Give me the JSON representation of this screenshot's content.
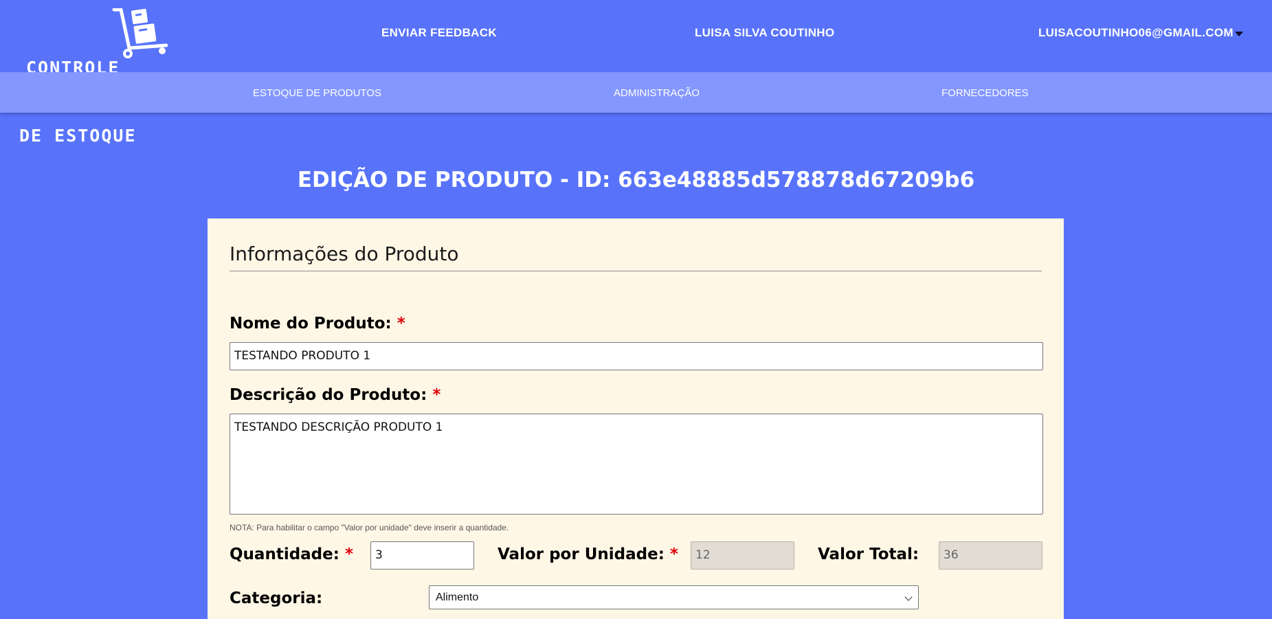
{
  "logo": {
    "line1": "CONTROLE",
    "line2": "DE ESTOQUE",
    "icon": "hand-truck-boxes-icon"
  },
  "header": {
    "feedback": "ENVIAR FEEDBACK",
    "user_name": "LUISA SILVA COUTINHO",
    "user_email": "LUISACOUTINHO06@GMAIL.COM",
    "dropdown_icon": "caret-down-icon"
  },
  "nav": {
    "items": [
      {
        "label": "ESTOQUE DE PRODUTOS"
      },
      {
        "label": "ADMINISTRAÇÃO"
      },
      {
        "label": "FORNECEDORES"
      }
    ]
  },
  "page": {
    "title": "EDIÇÃO DE PRODUTO - ID: 663e48885d578878d67209b6"
  },
  "form": {
    "section_title": "Informações do Produto",
    "required_mark": "*",
    "nome": {
      "label": "Nome do Produto:",
      "value": "TESTANDO PRODUTO 1"
    },
    "descricao": {
      "label": "Descrição do Produto:",
      "value": "TESTANDO DESCRIÇÃO PRODUTO 1"
    },
    "note": "NOTA: Para habilitar o campo \"Valor por unidade\" deve inserir a quantidade.",
    "quantidade": {
      "label": "Quantidade:",
      "value": "3"
    },
    "valor_unidade": {
      "label": "Valor por Unidade:",
      "value": "12"
    },
    "valor_total": {
      "label": "Valor Total:",
      "value": "36"
    },
    "categoria": {
      "label": "Categoria:",
      "selected": "Alimento"
    }
  },
  "colors": {
    "background": "#5873fa",
    "subnav": "#8497ff",
    "card": "#fff7e6",
    "required": "#e0000a"
  }
}
